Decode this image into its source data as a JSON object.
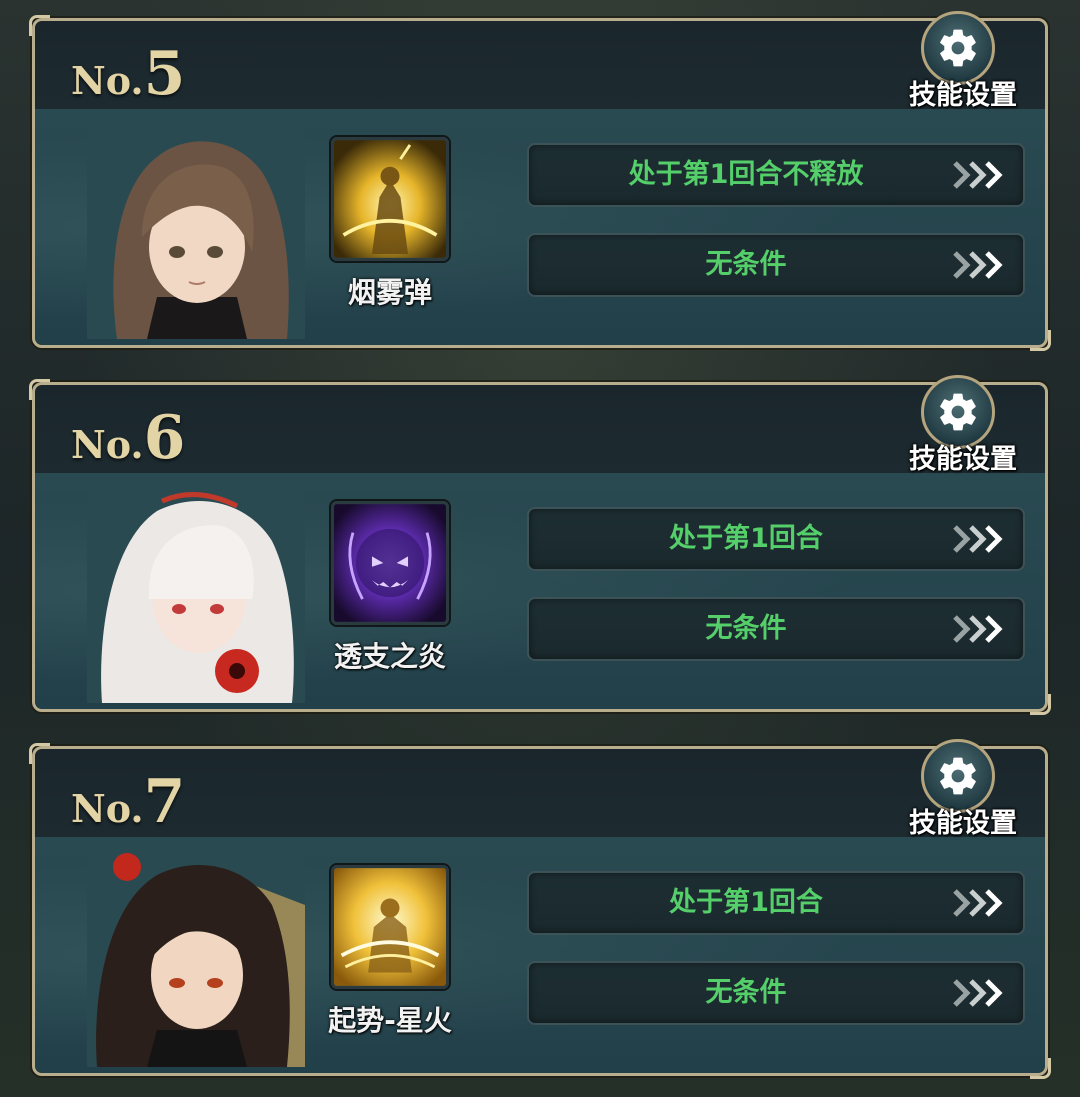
{
  "cards": [
    {
      "no_prefix": "No.",
      "number": "5",
      "settings_label": "技能设置",
      "skill_name": "烟雾弹",
      "condition1": "处于第1回合不释放",
      "condition2": "无条件"
    },
    {
      "no_prefix": "No.",
      "number": "6",
      "settings_label": "技能设置",
      "skill_name": "透支之炎",
      "condition1": "处于第1回合",
      "condition2": "无条件"
    },
    {
      "no_prefix": "No.",
      "number": "7",
      "settings_label": "技能设置",
      "skill_name": "起势-星火",
      "condition1": "处于第1回合",
      "condition2": "无条件"
    }
  ],
  "colors": {
    "condition_text": "#55cf6a",
    "slot_number": "#e3d4a6",
    "card_frame": "#b8ad8c"
  },
  "icons": {
    "settings": "gear-icon",
    "condition_arrow": "triple-chevron-right-icon"
  }
}
